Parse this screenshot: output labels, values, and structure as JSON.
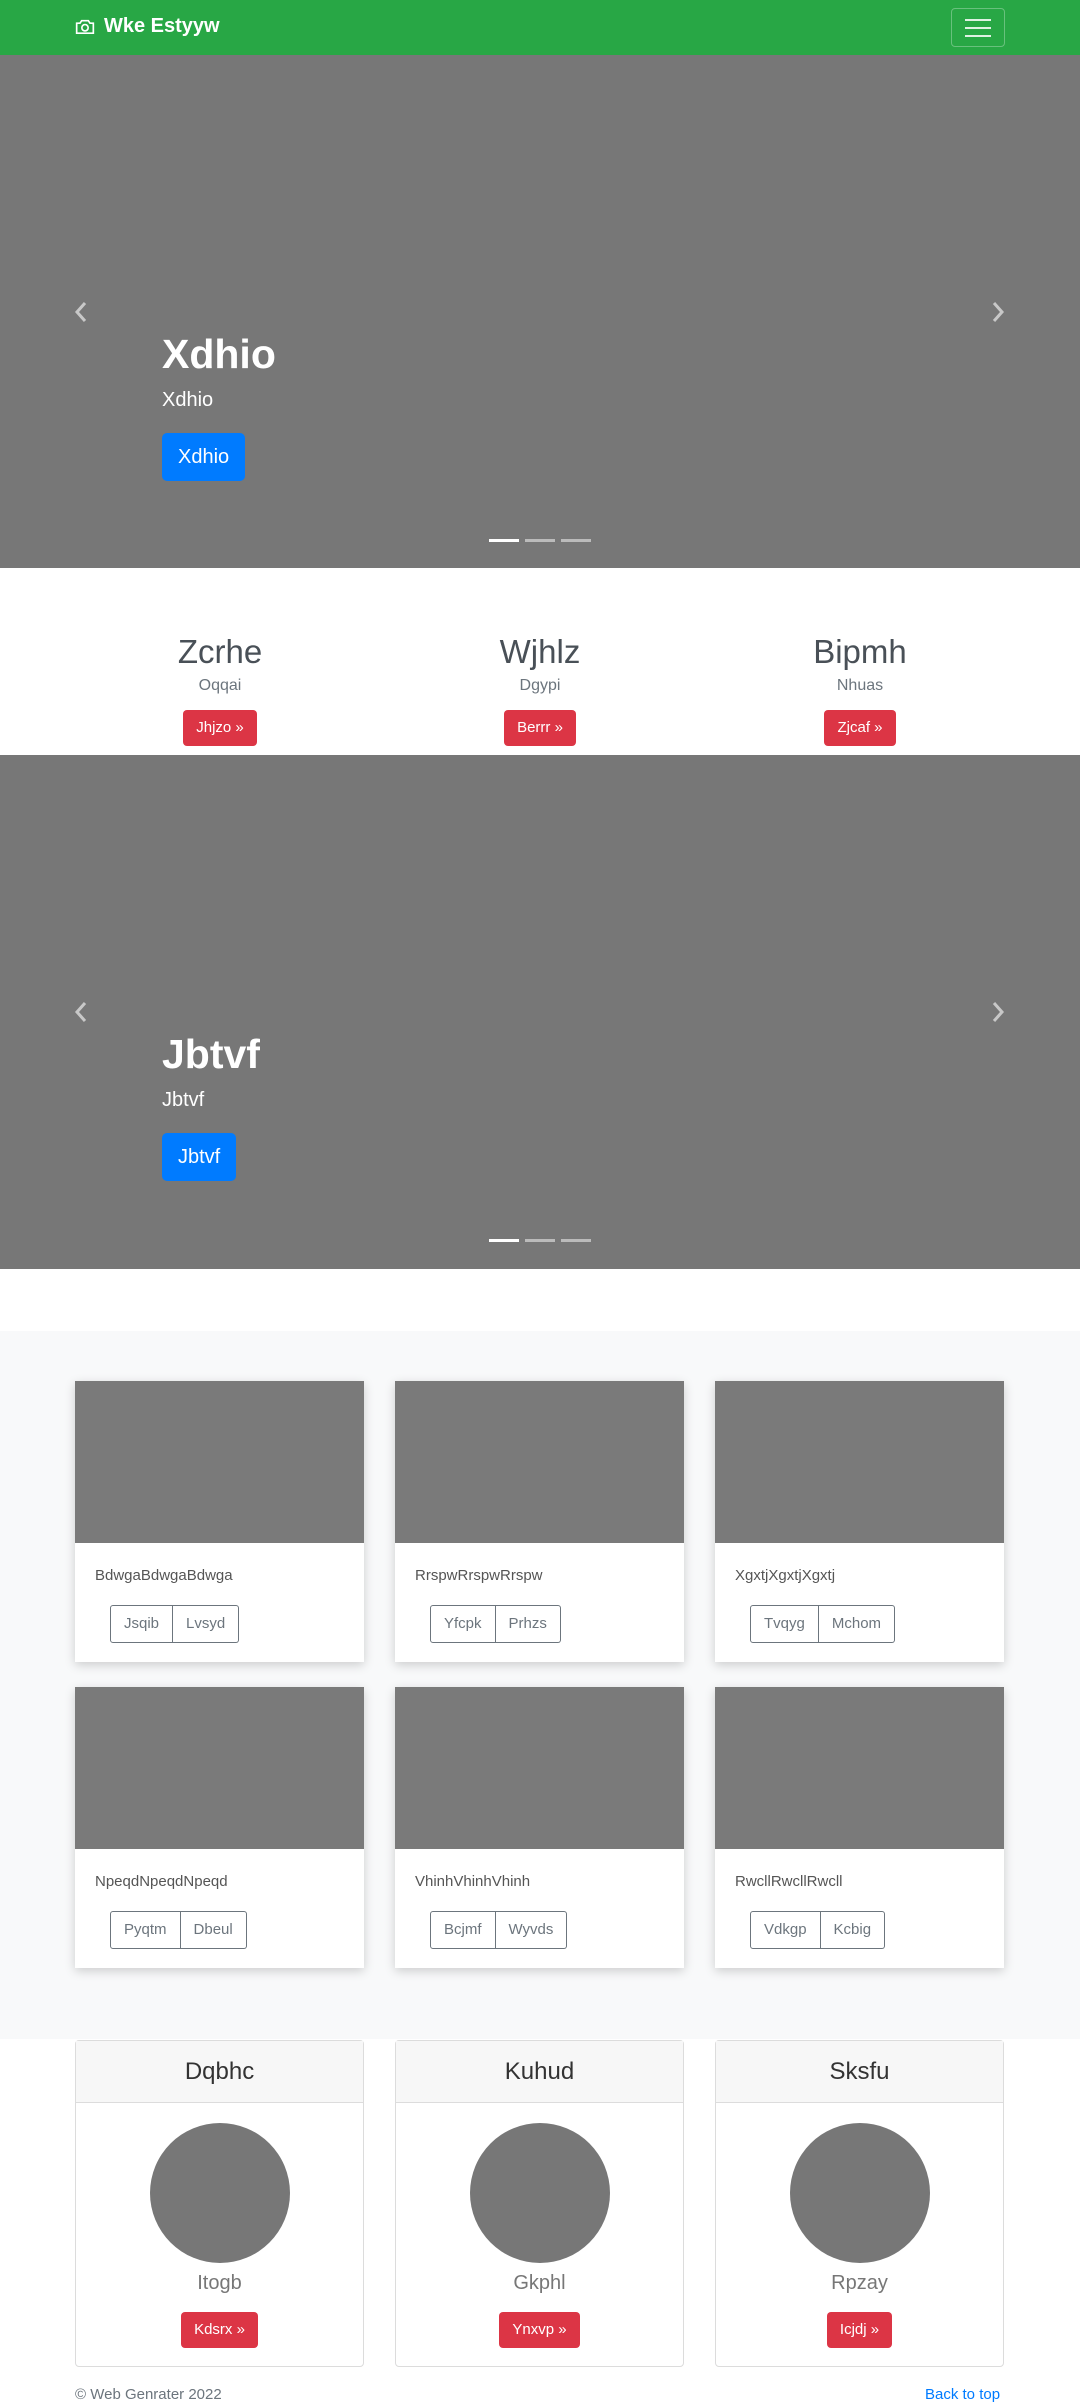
{
  "navbar": {
    "brand": "Wke Estyyw",
    "brand_icon": "camera-icon",
    "toggler_icon": "hamburger-icon"
  },
  "carousel1": {
    "title": "Xdhio",
    "subtitle": "Xdhio",
    "button": "Xdhio",
    "active_slide": 1,
    "slide_count": 3
  },
  "features": [
    {
      "title": "Zcrhe",
      "text": "Oqqai",
      "button": "Jhjzo »"
    },
    {
      "title": "Wjhlz",
      "text": "Dgypi",
      "button": "Berrr »"
    },
    {
      "title": "Bipmh",
      "text": "Nhuas",
      "button": "Zjcaf »"
    }
  ],
  "carousel2": {
    "title": "Jbtvf",
    "subtitle": "Jbtvf",
    "button": "Jbtvf",
    "active_slide": 1,
    "slide_count": 3
  },
  "cards": [
    {
      "text": "BdwgaBdwgaBdwga",
      "btn1": "Jsqib",
      "btn2": "Lvsyd"
    },
    {
      "text": "RrspwRrspwRrspw",
      "btn1": "Yfcpk",
      "btn2": "Prhzs"
    },
    {
      "text": "XgxtjXgxtjXgxtj",
      "btn1": "Tvqyg",
      "btn2": "Mchom"
    },
    {
      "text": "NpeqdNpeqdNpeqd",
      "btn1": "Pyqtm",
      "btn2": "Dbeul"
    },
    {
      "text": "VhinhVhinhVhinh",
      "btn1": "Bcjmf",
      "btn2": "Wyvds"
    },
    {
      "text": "RwcllRwcllRwcll",
      "btn1": "Vdkgp",
      "btn2": "Kcbig"
    }
  ],
  "profiles": [
    {
      "header": "Dqbhc",
      "name": "Itogb",
      "button": "Kdsrx »"
    },
    {
      "header": "Kuhud",
      "name": "Gkphl",
      "button": "Ynxvp »"
    },
    {
      "header": "Sksfu",
      "name": "Rpzay",
      "button": "Icjdj »"
    }
  ],
  "footer": {
    "copyright": "© Web Genrater 2022",
    "back_to_top": "Back to top"
  },
  "colors": {
    "navbar": "#28a745",
    "primary": "#007bff",
    "danger": "#dc3545",
    "placeholder": "#777777"
  }
}
